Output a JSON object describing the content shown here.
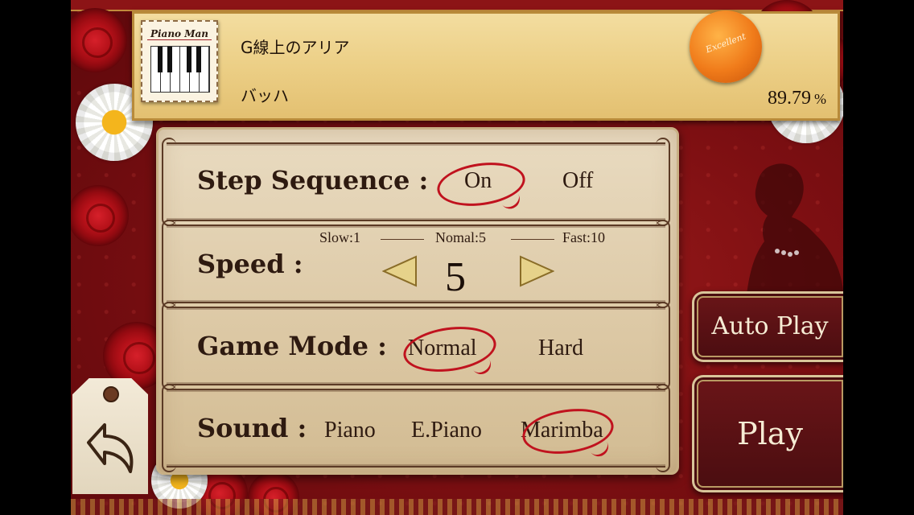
{
  "song": {
    "title": "G線上のアリア",
    "composer": "バッハ",
    "score": "89.79",
    "score_unit": "%",
    "stamp_logo": "Piano Man",
    "seal_text": "Excellent"
  },
  "settings": {
    "step_sequence": {
      "label": "Step Sequence :",
      "options": [
        "On",
        "Off"
      ],
      "selected": "On"
    },
    "speed": {
      "label": "Speed :",
      "slow_label": "Slow:1",
      "normal_label": "Nomal:5",
      "fast_label": "Fast:10",
      "value": "5"
    },
    "game_mode": {
      "label": "Game Mode :",
      "options": [
        "Normal",
        "Hard"
      ],
      "selected": "Normal"
    },
    "sound": {
      "label": "Sound :",
      "options": [
        "Piano",
        "E.Piano",
        "Marimba"
      ],
      "selected": "Marimba"
    }
  },
  "buttons": {
    "auto_play": "Auto Play",
    "play": "Play"
  },
  "icons": {
    "back": "back-arrow-icon",
    "seal": "excellent-seal-icon",
    "speed_decrease": "left-triangle-icon",
    "speed_increase": "right-triangle-icon"
  },
  "colors": {
    "background": "#7d0f12",
    "selection_circle": "#c0121e",
    "panel": "#e9dbc1",
    "button": "#5a1114",
    "button_text": "#f6ecd4"
  }
}
